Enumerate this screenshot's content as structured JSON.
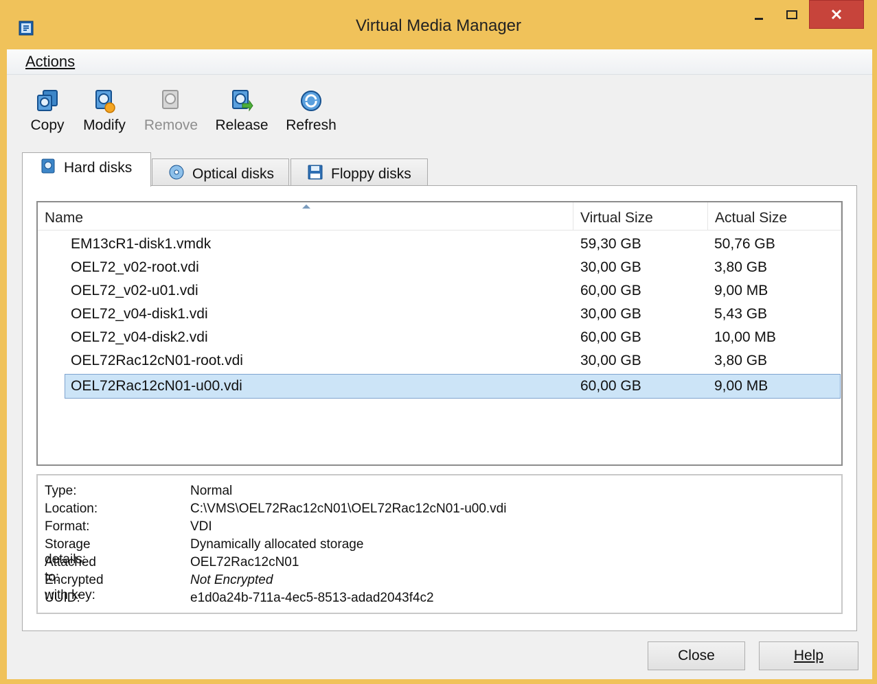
{
  "window": {
    "title": "Virtual Media Manager"
  },
  "menu": {
    "actions_label": "Actions"
  },
  "toolbar": {
    "items": [
      {
        "label": "Copy",
        "icon": "copy-disk-icon",
        "enabled": true
      },
      {
        "label": "Modify",
        "icon": "modify-disk-icon",
        "enabled": true
      },
      {
        "label": "Remove",
        "icon": "remove-disk-icon",
        "enabled": false
      },
      {
        "label": "Release",
        "icon": "release-disk-icon",
        "enabled": true
      },
      {
        "label": "Refresh",
        "icon": "refresh-icon",
        "enabled": true
      }
    ]
  },
  "tabs": [
    {
      "label": "Hard disks",
      "icon": "hard-disk-icon",
      "active": true
    },
    {
      "label": "Optical disks",
      "icon": "optical-disk-icon",
      "active": false
    },
    {
      "label": "Floppy disks",
      "icon": "floppy-disk-icon",
      "active": false
    }
  ],
  "list": {
    "columns": [
      "Name",
      "Virtual Size",
      "Actual Size"
    ],
    "rows": [
      {
        "name": "EM13cR1-disk1.vmdk",
        "virtual": "59,30 GB",
        "actual": "50,76 GB",
        "selected": false
      },
      {
        "name": "OEL72_v02-root.vdi",
        "virtual": "30,00 GB",
        "actual": "3,80 GB",
        "selected": false
      },
      {
        "name": "OEL72_v02-u01.vdi",
        "virtual": "60,00 GB",
        "actual": "9,00 MB",
        "selected": false
      },
      {
        "name": "OEL72_v04-disk1.vdi",
        "virtual": "30,00 GB",
        "actual": "5,43 GB",
        "selected": false
      },
      {
        "name": "OEL72_v04-disk2.vdi",
        "virtual": "60,00 GB",
        "actual": "10,00 MB",
        "selected": false
      },
      {
        "name": "OEL72Rac12cN01-root.vdi",
        "virtual": "30,00 GB",
        "actual": "3,80 GB",
        "selected": false
      },
      {
        "name": "OEL72Rac12cN01-u00.vdi",
        "virtual": "60,00 GB",
        "actual": "9,00 MB",
        "selected": true
      }
    ]
  },
  "details": [
    {
      "label": "Type:",
      "value": "Normal"
    },
    {
      "label": "Location:",
      "value": "C:\\VMS\\OEL72Rac12cN01\\OEL72Rac12cN01-u00.vdi"
    },
    {
      "label": "Format:",
      "value": "VDI"
    },
    {
      "label": "Storage details:",
      "value": "Dynamically allocated storage"
    },
    {
      "label": "Attached to:",
      "value": "OEL72Rac12cN01"
    },
    {
      "label": "Encrypted with key:",
      "value": "Not Encrypted"
    },
    {
      "label": "UUID:",
      "value": "e1d0a24b-711a-4ec5-8513-adad2043f4c2"
    }
  ],
  "buttons": {
    "close": "Close",
    "help": "Help"
  },
  "colors": {
    "frame": "#f0c25a",
    "close_button": "#c7443b",
    "selection": "#cce4f7"
  }
}
